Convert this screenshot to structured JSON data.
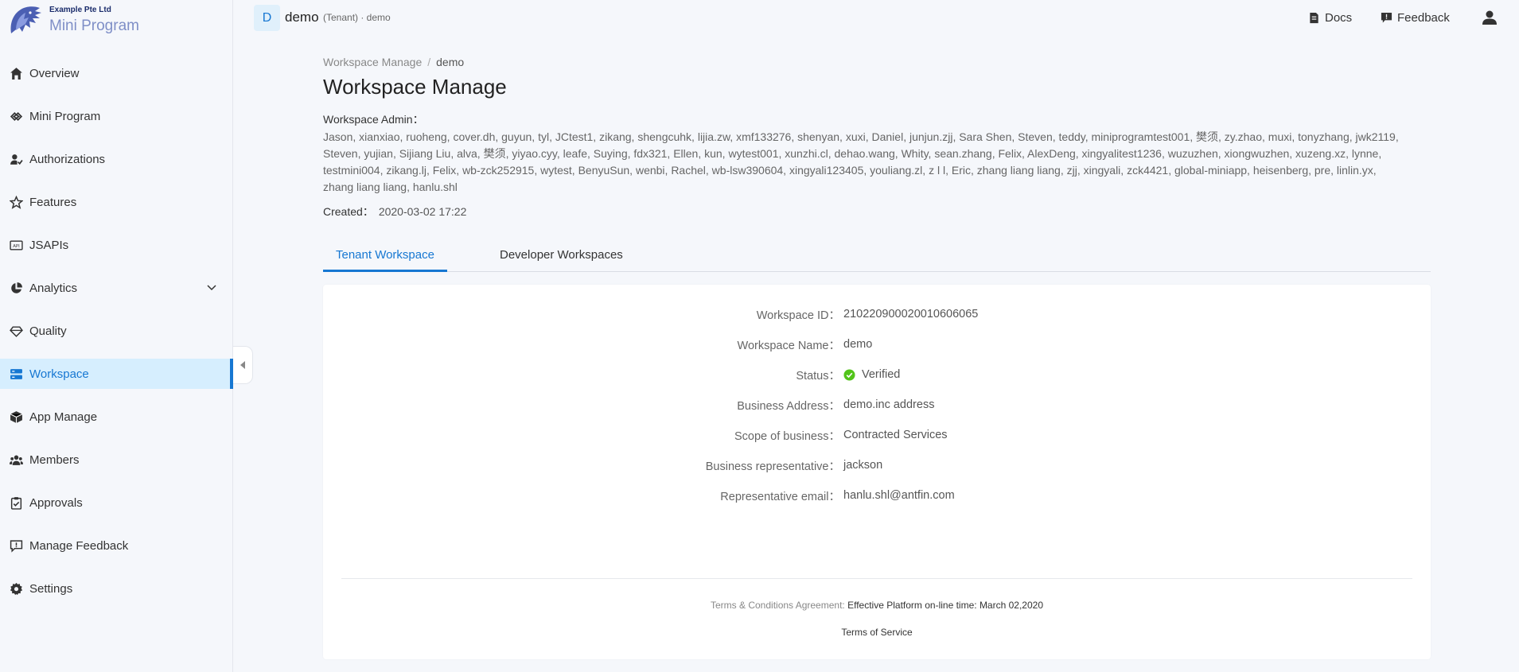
{
  "brand": {
    "company": "Example Pte Ltd",
    "product": "Mini Program"
  },
  "sidebar": {
    "items": [
      {
        "label": "Overview",
        "icon": "home-icon"
      },
      {
        "label": "Mini Program",
        "icon": "link-icon"
      },
      {
        "label": "Authorizations",
        "icon": "user-check-icon"
      },
      {
        "label": "Features",
        "icon": "star-icon"
      },
      {
        "label": "JSAPIs",
        "icon": "api-icon"
      },
      {
        "label": "Analytics",
        "icon": "pie-chart-icon"
      },
      {
        "label": "Quality",
        "icon": "diamond-icon"
      },
      {
        "label": "Workspace",
        "icon": "workspace-icon"
      },
      {
        "label": "App Manage",
        "icon": "cube-icon"
      },
      {
        "label": "Members",
        "icon": "team-icon"
      },
      {
        "label": "Approvals",
        "icon": "clipboard-check-icon"
      },
      {
        "label": "Manage Feedback",
        "icon": "feedback-icon"
      },
      {
        "label": "Settings",
        "icon": "gear-icon"
      }
    ],
    "active": "Workspace"
  },
  "header": {
    "tenant_initial": "D",
    "tenant_name": "demo",
    "tenant_meta": "(Tenant) · demo",
    "docs_label": "Docs",
    "feedback_label": "Feedback"
  },
  "breadcrumb": {
    "parent": "Workspace Manage",
    "separator": "/",
    "current": "demo"
  },
  "page": {
    "title": "Workspace Manage",
    "admin_label": "Workspace Admin：",
    "admins": "Jason, xianxiao, ruoheng, cover.dh, guyun, tyl, JCtest1, zikang, shengcuhk, lijia.zw, xmf133276, shenyan, xuxi, Daniel, junjun.zjj, Sara Shen, Steven, teddy, miniprogramtest001, 樊须, zy.zhao, muxi, tonyzhang, jwk2119, Steven, yujian, Sijiang Liu, alva, 樊须, yiyao.cyy, leafe, Suying, fdx321, Ellen, kun, wytest001, xunzhi.cl, dehao.wang, Whity, sean.zhang, Felix, AlexDeng, xingyalitest1236, wuzuzhen, xiongwuzhen, xuzeng.xz, lynne, testmini004, zikang.lj, Felix, wb-zck252915, wytest, BenyuSun, wenbi, Rachel, wb-lsw390604, xingyali123405, youliang.zl, z l l, Eric, zhang liang liang, zjj, xingyali, zck4421, global-miniapp, heisenberg, pre, linlin.yx, zhang liang liang, hanlu.shl",
    "created_label": "Created：",
    "created_value": "2020-03-02 17:22"
  },
  "tabs": [
    {
      "label": "Tenant Workspace",
      "active": true
    },
    {
      "label": "Developer Workspaces",
      "active": false
    }
  ],
  "details": {
    "fields": [
      {
        "label": "Workspace ID：",
        "value": "2102209000200106060​65"
      },
      {
        "label": "Workspace Name：",
        "value": "demo"
      },
      {
        "label": "Status：",
        "value": "Verified"
      },
      {
        "label": "Business Address：",
        "value": "demo.inc address"
      },
      {
        "label": "Scope of business：",
        "value": "Contracted Services"
      },
      {
        "label": "Business representative：",
        "value": "jackson"
      },
      {
        "label": "Representative email：",
        "value": "hanlu.shl@antfin.com"
      }
    ],
    "terms_label": "Terms & Conditions Agreement:",
    "terms_value": "Effective Platform on-line time: March 02,2020",
    "tos_label": "Terms of Service"
  },
  "colors": {
    "accent": "#1677d2",
    "active_bg": "#d6eefe",
    "verified": "#52c41a",
    "page_bg": "#f5f7fb"
  }
}
